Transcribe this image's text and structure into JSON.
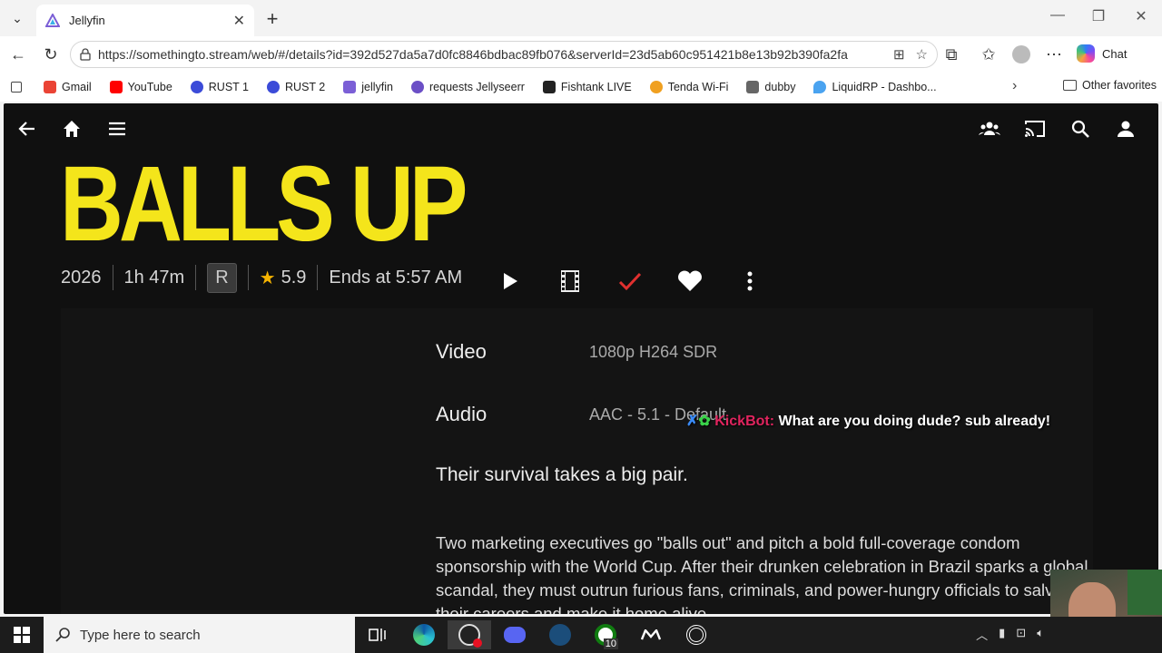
{
  "browser": {
    "tab_title": "Jellyfin",
    "url": "https://somethingto.stream/web/#/details?id=392d527da5a7d0fc8846bdbac89fb076&serverId=23d5ab60c951421b8e13b92b390fa2fa",
    "chat_label": "Chat",
    "bookmarks": [
      {
        "label": "Gmail",
        "color": "#ea4335"
      },
      {
        "label": "YouTube",
        "color": "#ff0000"
      },
      {
        "label": "RUST 1",
        "color": "#3b4bd8"
      },
      {
        "label": "RUST 2",
        "color": "#3b4bd8"
      },
      {
        "label": "jellyfin",
        "color": "#7b5fd6"
      },
      {
        "label": "requests Jellyseerr",
        "color": "#6b4fc6"
      },
      {
        "label": "Fishtank LIVE",
        "color": "#222222"
      },
      {
        "label": "Tenda Wi-Fi",
        "color": "#f0a020"
      },
      {
        "label": "dubby",
        "color": "#666666"
      },
      {
        "label": "LiquidRP - Dashbo...",
        "color": "#4aa3f0"
      }
    ],
    "other_favorites": "Other favorites"
  },
  "movie": {
    "title": "BALLS UP",
    "year": "2026",
    "runtime": "1h 47m",
    "rating": "R",
    "community_rating": "5.9",
    "ends_at": "Ends at 5:57 AM",
    "video_label": "Video",
    "video_value": "1080p H264 SDR",
    "audio_label": "Audio",
    "audio_value": "AAC - 5.1 - Default",
    "tagline": "Their survival takes a big pair.",
    "overview": "Two marketing executives go \"balls out\" and pitch a bold full-coverage condom sponsorship with the World Cup. After their drunken celebration in Brazil sparks a global scandal, they must outrun furious fans, criminals, and power-hungry officials to salvage their careers and make it home alive.",
    "title_color": "#f4e51b"
  },
  "overlay": {
    "bot_name": "KickBot:",
    "message": "What are you doing dude? sub already!"
  },
  "taskbar": {
    "search_placeholder": "Type here to search",
    "xbox_badge": "10"
  }
}
